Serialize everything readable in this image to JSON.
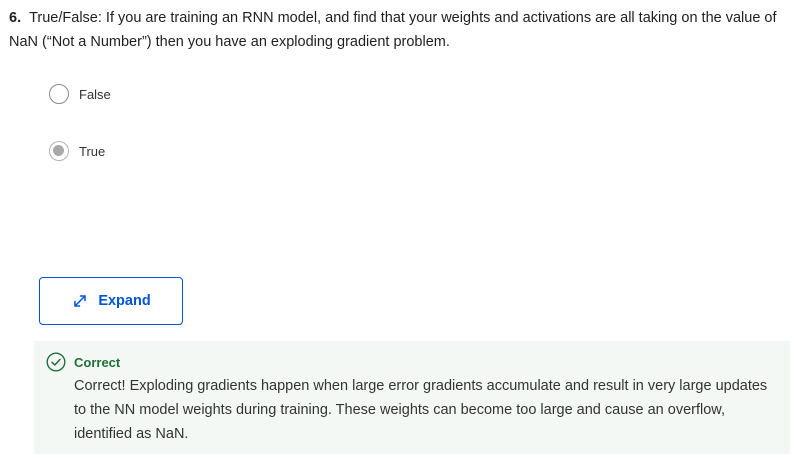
{
  "question": {
    "number": "6.",
    "text": "True/False: If you are training an RNN model, and find that your weights and activations are all taking on the value of NaN (“Not a Number”) then you have an exploding gradient problem."
  },
  "options": [
    {
      "label": "False",
      "selected": false
    },
    {
      "label": "True",
      "selected": true
    }
  ],
  "expand_button": {
    "label": "Expand",
    "icon": "expand-arrows-icon"
  },
  "feedback": {
    "status": "Correct",
    "icon": "check-circle-icon",
    "text": "Correct! Exploding gradients happen when large error gradients accumulate and result in very large updates to the NN model weights during training. These weights can become too large and cause an overflow, identified as NaN."
  },
  "colors": {
    "accent_blue": "#0056d2",
    "correct_green": "#1f6f3b",
    "feedback_bg": "#f4f8f5",
    "selected_radio": "#a9a9a9"
  }
}
